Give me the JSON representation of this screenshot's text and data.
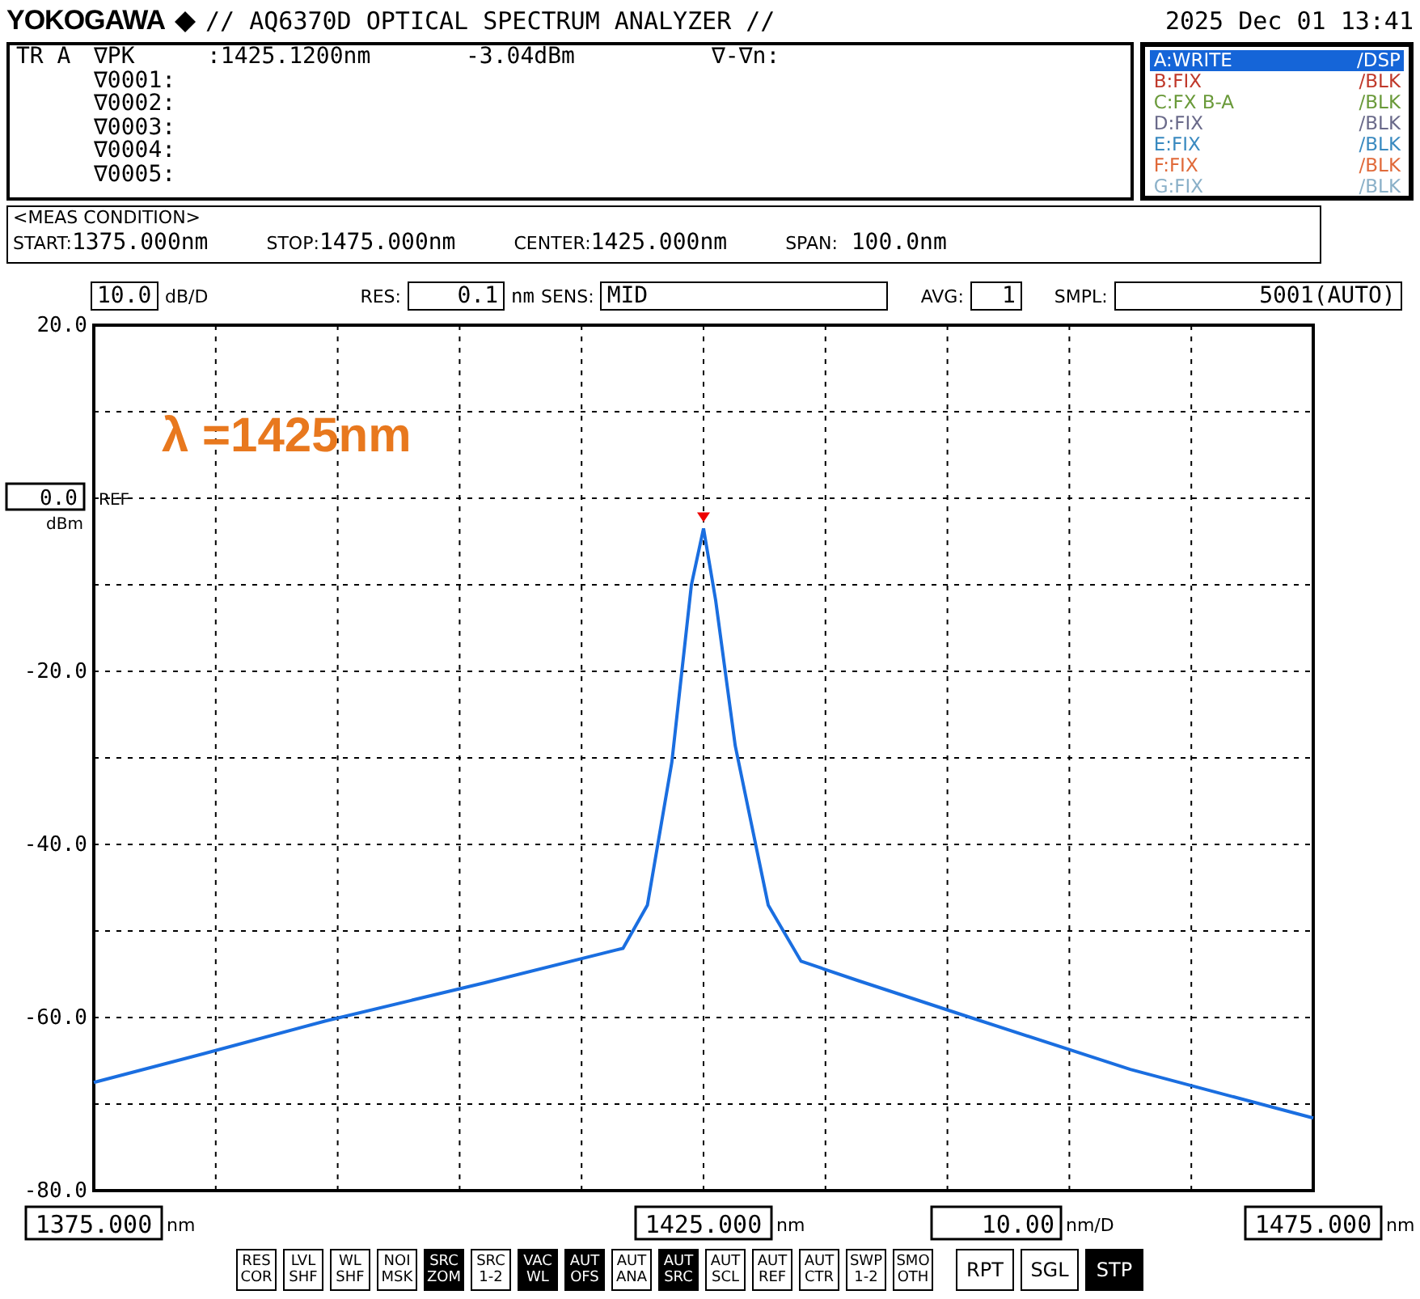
{
  "header": {
    "brand": "YOKOGAWA",
    "title": "// AQ6370D OPTICAL SPECTRUM ANALYZER //",
    "datetime": "2025 Dec 01 13:41"
  },
  "marker_panel": {
    "trace": "TR A",
    "peak_label": "∇PK",
    "peak_wavelength": ":1425.1200nm",
    "peak_level": "-3.04dBm",
    "delta_label": "∇-∇n:",
    "markers": [
      "∇0001:",
      "∇0002:",
      "∇0003:",
      "∇0004:",
      "∇0005:"
    ]
  },
  "traces": [
    {
      "label": "A:WRITE",
      "mode": "/DSP",
      "color": "#1565d8",
      "selected": true
    },
    {
      "label": "B:FIX",
      "mode": "/BLK",
      "color": "#c0392b",
      "selected": false
    },
    {
      "label": "C:FX B-A",
      "mode": "/BLK",
      "color": "#6a9a3a",
      "selected": false
    },
    {
      "label": "D:FIX",
      "mode": "/BLK",
      "color": "#6a6a8a",
      "selected": false
    },
    {
      "label": "E:FIX",
      "mode": "/BLK",
      "color": "#3a8ac0",
      "selected": false
    },
    {
      "label": "F:FIX",
      "mode": "/BLK",
      "color": "#e06a3a",
      "selected": false
    },
    {
      "label": "G:FIX",
      "mode": "/BLK",
      "color": "#8ab0c8",
      "selected": false
    }
  ],
  "meas_condition": {
    "title": "<MEAS CONDITION>",
    "items": [
      {
        "label": "START:",
        "value": "1375.000nm"
      },
      {
        "label": "STOP:",
        "value": "1475.000nm"
      },
      {
        "label": "CENTER:",
        "value": "1425.000nm"
      },
      {
        "label": "SPAN:",
        "value": " 100.0nm"
      }
    ]
  },
  "settings": {
    "scale": "10.0",
    "scale_unit": "dB/D",
    "res_label": "RES:",
    "res": "0.1",
    "res_unit": "nm",
    "sens_label": "SENS:",
    "sens": "MID",
    "avg_label": "AVG:",
    "avg": "1",
    "smpl_label": "SMPL:",
    "smpl": "5001(AUTO)"
  },
  "plot": {
    "ref_value": "0.0",
    "ref_label": "REF",
    "ref_unit": "dBm",
    "chart_data": {
      "type": "line",
      "x": [
        1375,
        1384.5,
        1394,
        1407,
        1418.4,
        1420.4,
        1422.4,
        1424,
        1425,
        1426,
        1427.6,
        1430.3,
        1433,
        1437.6,
        1446.9,
        1460,
        1475
      ],
      "xlim": [
        1375,
        1475
      ],
      "ylim": [
        -80,
        20
      ],
      "grid": true,
      "xticks": [
        {
          "value": 1375,
          "label": "1375.000"
        },
        {
          "value": 1425,
          "label": "1425.000"
        },
        {
          "value": 1475,
          "label": "1475.000"
        }
      ],
      "yticks": [
        {
          "value": 20,
          "label": "20.0"
        },
        {
          "value": -20,
          "label": "-20.0"
        },
        {
          "value": -40,
          "label": "-40.0"
        },
        {
          "value": -60,
          "label": "-60.0"
        },
        {
          "value": -80,
          "label": "-80.0"
        }
      ],
      "series": [
        {
          "color": "#1a6ee0",
          "values": [
            -67.5,
            -64,
            -60.4,
            -56,
            -52,
            -47,
            -30.5,
            -10,
            -3.5,
            -11.8,
            -28.6,
            -47,
            -53.5,
            -55.7,
            -60,
            -66,
            -71.6
          ]
        }
      ],
      "annotations": [
        {
          "text": "λ =1425nm"
        }
      ]
    },
    "x_units": [
      "nm",
      "nm",
      "nm"
    ],
    "x_scale": "10.00",
    "x_scale_unit": "nm/D"
  },
  "softkeys": [
    {
      "lines": [
        "RES",
        "COR"
      ],
      "on": false
    },
    {
      "lines": [
        "LVL",
        "SHF"
      ],
      "on": false
    },
    {
      "lines": [
        "WL",
        "SHF"
      ],
      "on": false
    },
    {
      "lines": [
        "NOI",
        "MSK"
      ],
      "on": false
    },
    {
      "lines": [
        "SRC",
        "ZOM"
      ],
      "on": true
    },
    {
      "lines": [
        "SRC",
        "1-2"
      ],
      "on": false
    },
    {
      "lines": [
        "VAC",
        "WL"
      ],
      "on": true
    },
    {
      "lines": [
        "AUT",
        "OFS"
      ],
      "on": true
    },
    {
      "lines": [
        "AUT",
        "ANA"
      ],
      "on": false
    },
    {
      "lines": [
        "AUT",
        "SRC"
      ],
      "on": true
    },
    {
      "lines": [
        "AUT",
        "SCL"
      ],
      "on": false
    },
    {
      "lines": [
        "AUT",
        "REF"
      ],
      "on": false
    },
    {
      "lines": [
        "AUT",
        "CTR"
      ],
      "on": false
    },
    {
      "lines": [
        "SWP",
        "1-2"
      ],
      "on": false
    },
    {
      "lines": [
        "SMO",
        "OTH"
      ],
      "on": false
    }
  ],
  "sweep_keys": [
    {
      "label": "RPT",
      "on": false
    },
    {
      "label": "SGL",
      "on": false
    },
    {
      "label": "STP",
      "on": true
    }
  ]
}
